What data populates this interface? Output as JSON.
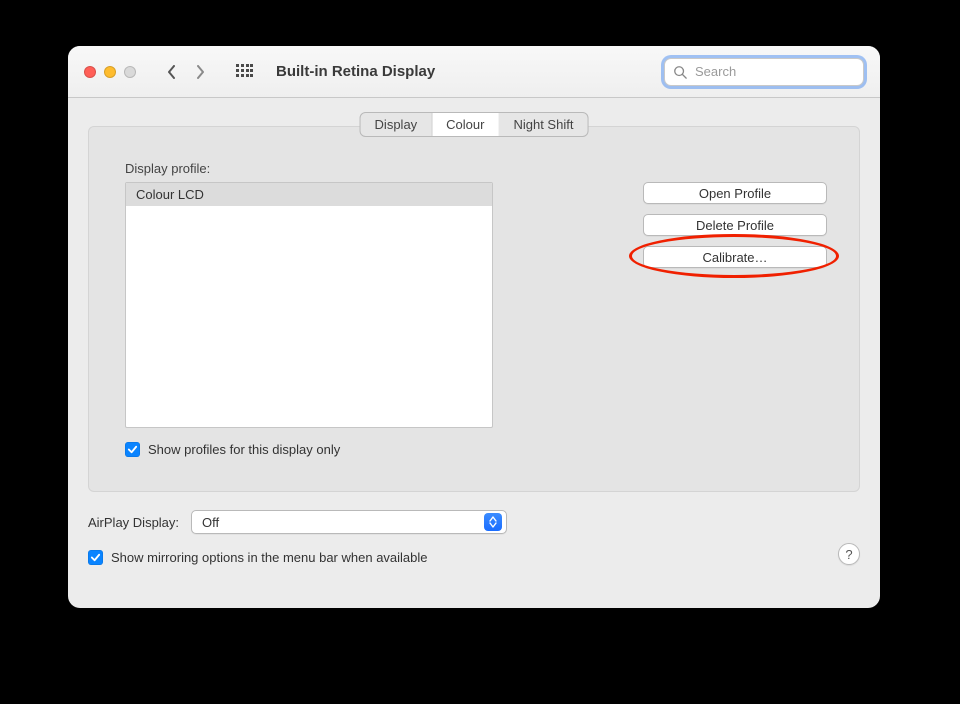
{
  "toolbar": {
    "title": "Built-in Retina Display",
    "search_placeholder": "Search"
  },
  "tabs": {
    "display": "Display",
    "colour": "Colour",
    "night_shift": "Night Shift",
    "selected": "colour"
  },
  "profile": {
    "label": "Display profile:",
    "items": [
      "Colour LCD"
    ],
    "selected_index": 0,
    "show_only_label": "Show profiles for this display only",
    "show_only_checked": true
  },
  "buttons": {
    "open_profile": "Open Profile",
    "delete_profile": "Delete Profile",
    "calibrate": "Calibrate…"
  },
  "airplay": {
    "label": "AirPlay Display:",
    "value": "Off"
  },
  "mirroring": {
    "label": "Show mirroring options in the menu bar when available",
    "checked": true
  },
  "help": "?"
}
